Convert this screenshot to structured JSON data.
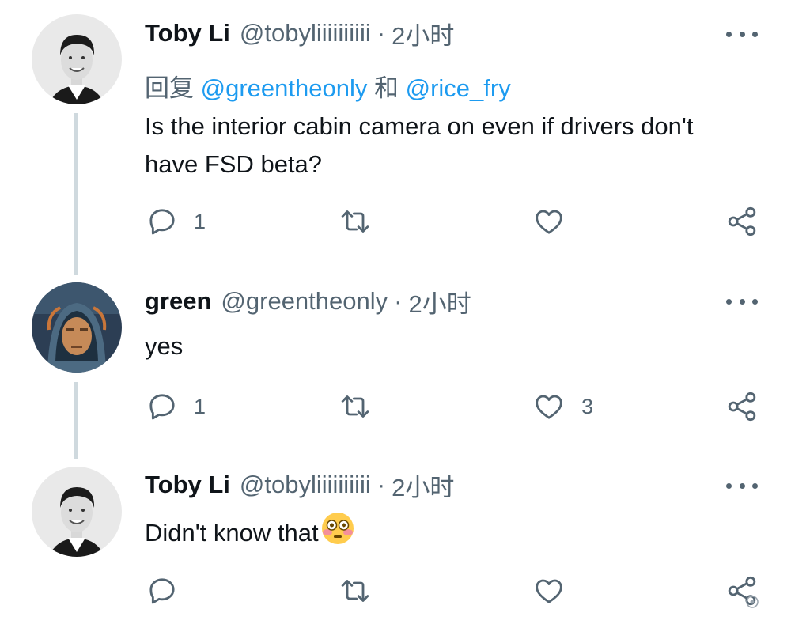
{
  "tweets": [
    {
      "author_name": "Toby Li",
      "handle": "@tobyliiiiiiiiii",
      "separator": "·",
      "time": "2小时",
      "reply_prefix": "回复",
      "reply_mention_1": "@greentheonly",
      "reply_conjunction": "和",
      "reply_mention_2": "@rice_fry",
      "text": "Is the interior cabin camera on even if drivers don't have FSD beta?",
      "reply_count": "1",
      "retweet_count": "",
      "like_count": ""
    },
    {
      "author_name": "green",
      "handle": "@greentheonly",
      "separator": "·",
      "time": "2小时",
      "text": "yes",
      "reply_count": "1",
      "retweet_count": "",
      "like_count": "3"
    },
    {
      "author_name": "Toby Li",
      "handle": "@tobyliiiiiiiiii",
      "separator": "·",
      "time": "2小时",
      "text": "Didn't know that",
      "emoji": "flushed-face",
      "reply_count": "",
      "retweet_count": "",
      "like_count": ""
    }
  ],
  "colors": {
    "text_primary": "#0f1419",
    "text_secondary": "#536471",
    "link": "#1d9bf0",
    "thread_line": "#cfd9de"
  },
  "icons": [
    "reply-icon",
    "retweet-icon",
    "like-icon",
    "share-icon",
    "more-options-icon"
  ]
}
